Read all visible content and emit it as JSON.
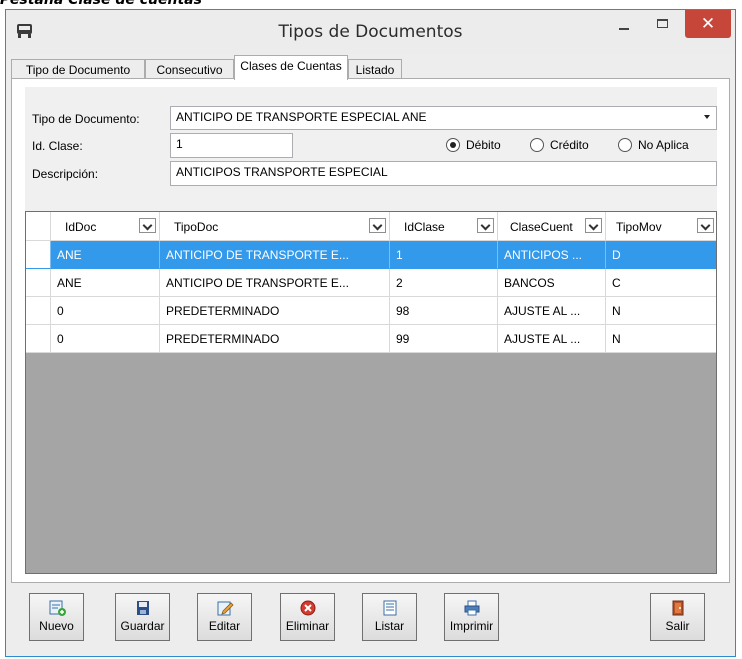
{
  "caption": "Pestaña Clase de cuentas",
  "window": {
    "title": "Tipos de Documentos"
  },
  "tabs": [
    {
      "label": "Tipo de Documento",
      "active": false
    },
    {
      "label": "Consecutivo",
      "active": false
    },
    {
      "label": "Clases de Cuentas",
      "active": true
    },
    {
      "label": "Listado",
      "active": false
    }
  ],
  "form": {
    "tipo_documento_label": "Tipo de Documento:",
    "tipo_documento_value": "ANTICIPO DE TRANSPORTE ESPECIAL ANE",
    "id_clase_label": "Id. Clase:",
    "id_clase_value": "1",
    "descripcion_label": "Descripción:",
    "descripcion_value": "ANTICIPOS TRANSPORTE ESPECIAL",
    "tipo_mov": {
      "options": [
        "Débito",
        "Crédito",
        "No Aplica"
      ],
      "selected": "Débito"
    }
  },
  "grid": {
    "columns": [
      "IdDoc",
      "TipoDoc",
      "IdClase",
      "ClaseCuent",
      "TipoMov"
    ],
    "rows": [
      [
        "ANE",
        "ANTICIPO DE TRANSPORTE E...",
        "1",
        "ANTICIPOS ...",
        "D"
      ],
      [
        "ANE",
        "ANTICIPO DE TRANSPORTE E...",
        "2",
        "BANCOS",
        "C"
      ],
      [
        "0",
        "PREDETERMINADO",
        "98",
        "AJUSTE AL ...",
        "N"
      ],
      [
        "0",
        "PREDETERMINADO",
        "99",
        "AJUSTE AL ...",
        "N"
      ]
    ],
    "selected_row": 0
  },
  "toolbar": {
    "nuevo": "Nuevo",
    "guardar": "Guardar",
    "editar": "Editar",
    "eliminar": "Eliminar",
    "listar": "Listar",
    "imprimir": "Imprimir",
    "salir": "Salir"
  },
  "colors": {
    "selection": "#3399ea",
    "close_button": "#c7463a",
    "window_border": "#2a8dd4"
  }
}
